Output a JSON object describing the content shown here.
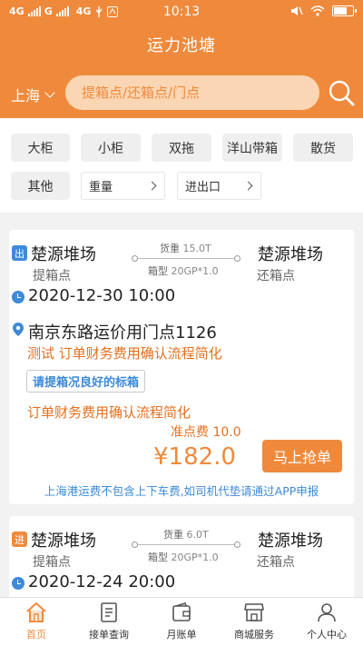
{
  "status_bar": {
    "network1": "4G",
    "network2": "G",
    "network3": "4G",
    "time": "10:13"
  },
  "app_title": "运力池塘",
  "search": {
    "city": "上海",
    "placeholder": "提箱点/还箱点/门点"
  },
  "filters": {
    "chips": [
      "大柜",
      "小柜",
      "双拖",
      "洋山带箱",
      "散货",
      "其他"
    ],
    "weight_label": "重量",
    "io_label": "进出口"
  },
  "orders": [
    {
      "direction": "出",
      "pickup_name": "楚源堆场",
      "pickup_label": "提箱点",
      "return_name": "楚源堆场",
      "return_label": "还箱点",
      "weight_label": "货重",
      "weight": "15.0T",
      "box_label": "箱型",
      "box": "20GP*1.0",
      "datetime": "2020-12-30 10:00",
      "address": "南京东路运价用门点1126",
      "note1": "测试 订单财务费用确认流程简化",
      "remark_tag": "请提箱况良好的标箱",
      "note2": "订单财务费用确认流程简化",
      "fee_label": "准点费 10.0",
      "price": "¥182.0",
      "button": "马上抢单",
      "notice": "上海港运费不包含上下车费,如司机代垫请通过APP申报"
    },
    {
      "direction": "进",
      "pickup_name": "楚源堆场",
      "pickup_label": "提箱点",
      "return_name": "楚源堆场",
      "return_label": "还箱点",
      "weight_label": "货重",
      "weight": "6.0T",
      "box_label": "箱型",
      "box": "20GP*1.0",
      "datetime": "2020-12-24 20:00"
    }
  ],
  "bottom_nav": [
    "首页",
    "接单查询",
    "月账单",
    "商城服务",
    "个人中心"
  ],
  "colors": {
    "brand": "#ef8a3c",
    "link_blue": "#3c8ad8",
    "accent_orange": "#e3701f"
  }
}
